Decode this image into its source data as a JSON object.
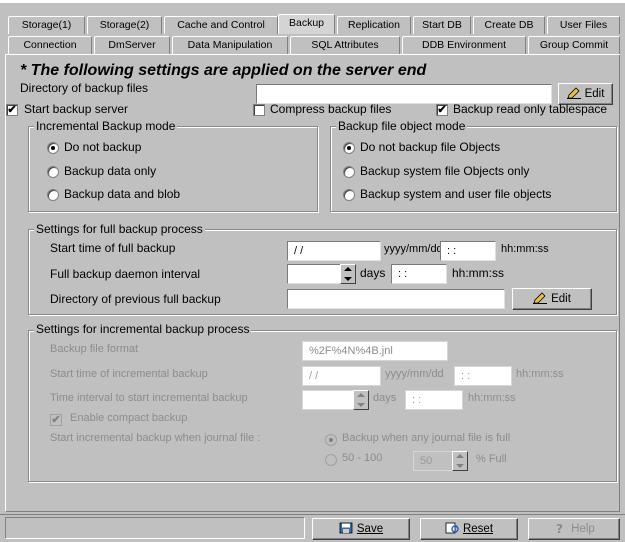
{
  "tabs_row1": [
    "Storage(1)",
    "Storage(2)",
    "Cache and Control",
    "Backup",
    "Replication",
    "Start DB",
    "Create DB",
    "User Files"
  ],
  "tabs_row2": [
    "Connection",
    "DmServer",
    "Data Manipulation",
    "SQL Attributes",
    "DDB Environment",
    "Group Commit"
  ],
  "title": "* The following settings are applied on the server end",
  "backup_dir_label": "Directory of backup files",
  "backup_dir_value": "",
  "edit_label": "Edit",
  "start_backup_server": "Start backup server",
  "compress_backup_files": "Compress backup files",
  "backup_read_only_tablespace": "Backup read only tablespace",
  "incremental_mode": {
    "legend": "Incremental Backup mode",
    "options": [
      "Do not backup",
      "Backup data only",
      "Backup data and blob"
    ]
  },
  "object_mode": {
    "legend": "Backup file object mode",
    "options": [
      "Do not backup file Objects",
      "Backup system file Objects only",
      "Backup system and user file objects"
    ]
  },
  "full_backup": {
    "legend": "Settings for full backup process",
    "start_time_label": "Start time of full backup",
    "date_value": "/   /",
    "date_format": "yyyy/mm/dd",
    "time_value": ":    :",
    "time_format": "hh:mm:ss",
    "daemon_interval_label": "Full backup daemon interval",
    "days_label": "days",
    "interval_time_value": ":    :",
    "prev_dir_label": "Directory of previous full backup",
    "prev_dir_value": ""
  },
  "incremental_backup": {
    "legend": "Settings for incremental backup process",
    "file_format_label": "Backup file format",
    "file_format_value": "%2F%4N%4B.jnl",
    "start_time_label": "Start time of incremental backup",
    "date_value": "/   /",
    "date_format": "yyyy/mm/dd",
    "time_value": ":    :",
    "time_format": "hh:mm:ss",
    "interval_label": "Time interval to start incremental backup",
    "days_label": "days",
    "interval_time_value": ":    :",
    "enable_compact": "Enable compact backup",
    "journal_label": "Start incremental backup when journal file :",
    "journal_full_option": "Backup when any journal file is full",
    "journal_range_option": "50 - 100",
    "percent_value": "50",
    "percent_label": "% Full"
  },
  "buttons": {
    "save": "Save",
    "reset": "Reset",
    "help": "Help"
  }
}
